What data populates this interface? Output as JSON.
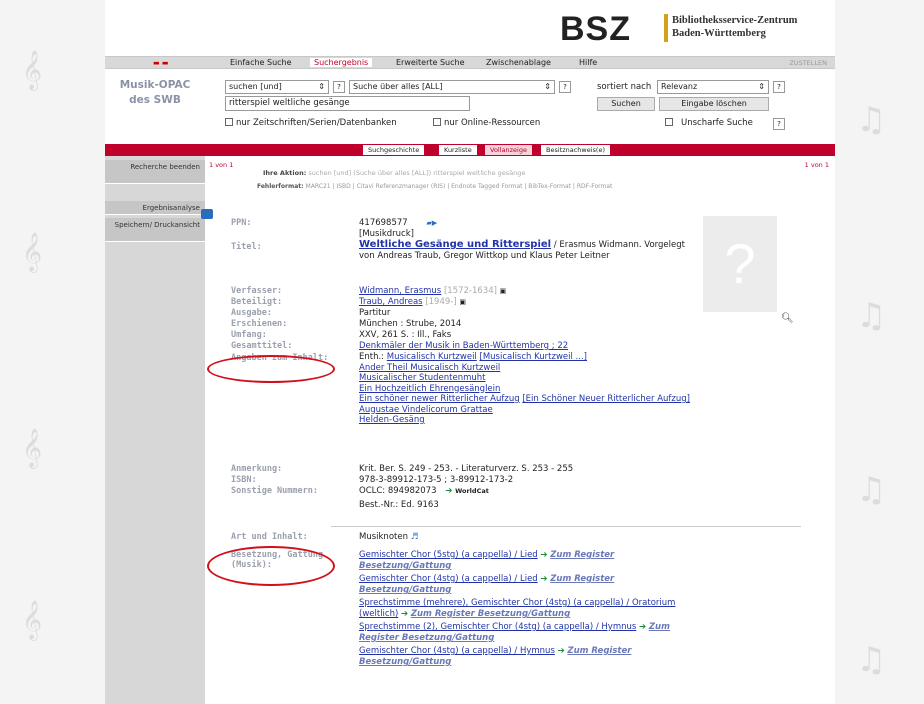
{
  "logo": {
    "mark": "BSZ",
    "line1": "Bibliotheksservice-Zentrum",
    "line2": "Baden-Württemberg"
  },
  "topnav": {
    "tabs": [
      "Einfache Suche",
      "Suchergebnis",
      "Erweiterte Suche",
      "Zwischenablage",
      "Hilfe"
    ],
    "right": "ZUSTELLEN"
  },
  "sidebar": {
    "title1": "Musik-OPAC",
    "title2": "des SWB",
    "items": [
      "Recherche beenden",
      "Ergebnisanalyse",
      "Speichern/ Druckansicht"
    ]
  },
  "search": {
    "operator": "suchen [und]",
    "field": "Suche über alles [ALL]",
    "query": "ritterspiel weltliche gesänge",
    "sort_label": "sortiert nach",
    "sort_value": "Relevanz",
    "search_btn": "Suchen",
    "clear_btn": "Eingabe löschen",
    "opt_journals": "nur Zeitschriften/Serien/Datenbanken",
    "opt_online": "nur Online-Ressourcen",
    "opt_fuzzy": "Unscharfe Suche",
    "help": "?"
  },
  "subtabs": [
    "Suchgeschichte",
    "Kurzliste",
    "Vollanzeige",
    "Besitznachweis(e)"
  ],
  "action": {
    "pager": "1 von 1",
    "pager_right": "1 von 1",
    "label": "Ihre Aktion:",
    "text": "suchen [und] (Suche über alles [ALL]) ritterspiel weltliche gesänge",
    "formats_label": "Fehlerformat: ",
    "formats": "MARC21 | ISBD | Citavi Referenzmanager (RIS) | Endnote Tagged Format | BibTex-Format | RDF-Format"
  },
  "record": {
    "labels": {
      "ppn": "PPN:",
      "title": "Titel:",
      "author": "Verfasser:",
      "contributor": "Beteiligt:",
      "edition": "Ausgabe:",
      "published": "Erschienen:",
      "extent": "Umfang:",
      "series": "Gesamttitel:",
      "contents": "Angaben zum Inhalt:",
      "note": "Anmerkung:",
      "isbn": "ISBN:",
      "other": "Sonstige Nummern:",
      "type": "Art und Inhalt:",
      "scoring": "Besetzung, Gattung (Musik):"
    },
    "ppn": "417698577",
    "type_note": "[Musikdruck]",
    "title_main": "Weltliche Gesänge und Ritterspiel",
    "title_rest": " / Erasmus Widmann. Vorgelegt von Andreas Traub, Gregor Wittkop und Klaus Peter Leitner",
    "author": "Widmann, Erasmus",
    "author_dates": " [1572-1634]",
    "contributor": "Traub, Andreas",
    "contributor_dates": " [1949-]",
    "edition": "Partitur",
    "published": "München : Strube, 2014",
    "extent": "XXV, 261 S. : Ill., Faks",
    "series": "Denkmäler der Musik in Baden-Württemberg ; 22",
    "contents_prefix": "Enth.: ",
    "contents": [
      "Musicalisch Kurtzweil",
      "[Musicalisch Kurtzweil ...]",
      "Ander Theil Musicalisch Kurtzweil",
      "Musicalischer Studentenmuht",
      "Ein Hochzeitlich Ehrengesänglein",
      "Ein schöner newer Ritterlicher Aufzug",
      "[Ein Schöner Neuer Ritterlicher Aufzug]",
      "Augustae Vindelicorum Grattae",
      "Helden-Gesäng"
    ],
    "note": "Krit. Ber. S. 249 - 253. - Literaturverz. S. 253 - 255",
    "isbn": "978-3-89912-173-5 ; 3-89912-173-2",
    "oclc": "OCLC: 894982073",
    "worldcat": "WorldCat",
    "best_nr": "Best.-Nr.: Ed. 9163",
    "type": "Musiknoten",
    "scoring": [
      {
        "pre": "Gemischter Chor (5stg) (a cappella) / Lied",
        "reg": "Zum Register Besetzung/Gattung"
      },
      {
        "pre": "Gemischter Chor (4stg) (a cappella) / Lied",
        "reg": "Zum Register Besetzung/Gattung"
      },
      {
        "pre": "Sprechstimme (mehrere), Gemischter Chor (4stg) (a cappella) / Oratorium (weltlich)",
        "reg": "Zum Register Besetzung/Gattung"
      },
      {
        "pre": "Sprechstimme (2), Gemischter Chor (4stg) (a cappella) / Hymnus",
        "reg": "Zum Register Besetzung/Gattung"
      },
      {
        "pre": "Gemischter Chor (4stg) (a cappella) / Hymnus",
        "reg": "Zum Register Besetzung/Gattung"
      }
    ],
    "cover_placeholder": "?"
  },
  "colors": {
    "accent": "#c0002c",
    "highlight_oval": "#d0101a",
    "link": "#2233aa"
  }
}
